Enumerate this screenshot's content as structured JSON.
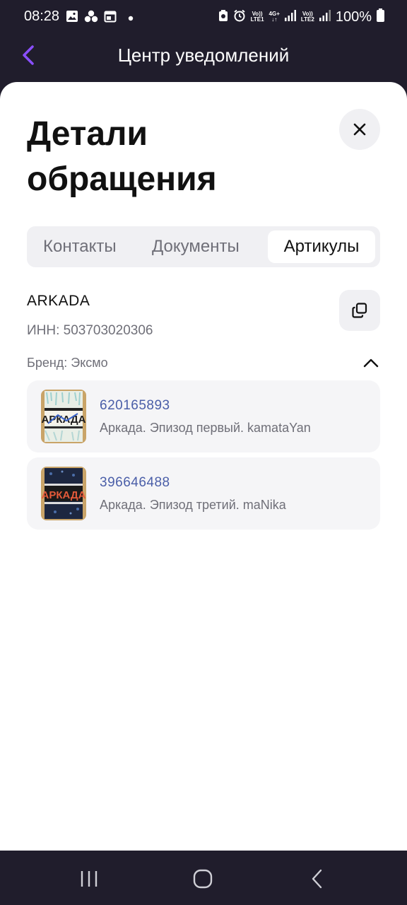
{
  "status_bar": {
    "time": "08:28",
    "battery_text": "100%",
    "sim1_top": "Vo))",
    "sim1_bottom": "LTE1",
    "net_4g": "4G+",
    "sim2_top": "Vo))",
    "sim2_bottom": "LTE2",
    "icons": [
      "gallery-icon",
      "dots-cluster-icon",
      "calendar-icon",
      "notification-dot-icon",
      "data-saver-icon",
      "alarm-icon",
      "signal-icon",
      "battery-icon"
    ]
  },
  "header": {
    "title": "Центр уведомлений",
    "back_icon": "chevron-left-icon",
    "accent_color": "#8a4fff"
  },
  "sheet": {
    "title": "Детали обращения",
    "close_icon": "close-icon"
  },
  "tabs": [
    {
      "label": "Контакты",
      "active": false
    },
    {
      "label": "Документы",
      "active": false
    },
    {
      "label": "Артикулы",
      "active": true
    }
  ],
  "seller": {
    "name": "ARKADA",
    "inn": "ИНН: 503703020306",
    "copy_icon": "copy-icon"
  },
  "brand": {
    "label": "Бренд: Эксмо",
    "toggle_icon": "chevron-up-icon"
  },
  "products": [
    {
      "sku": "620165893",
      "name": "Аркада. Эпизод первый. kamataYan",
      "cover_text": "АРКАДА"
    },
    {
      "sku": "396646488",
      "name": "Аркада. Эпизод третий. maNika",
      "cover_text": "АРКАДА"
    }
  ],
  "nav_bar": {
    "icons": [
      "recent-apps-icon",
      "home-icon",
      "nav-back-icon"
    ]
  },
  "colors": {
    "dark_bg": "#201d2c",
    "sku_link": "#4a5ea8",
    "muted_text": "#6f6f78",
    "chip_bg": "#f0f0f3"
  }
}
